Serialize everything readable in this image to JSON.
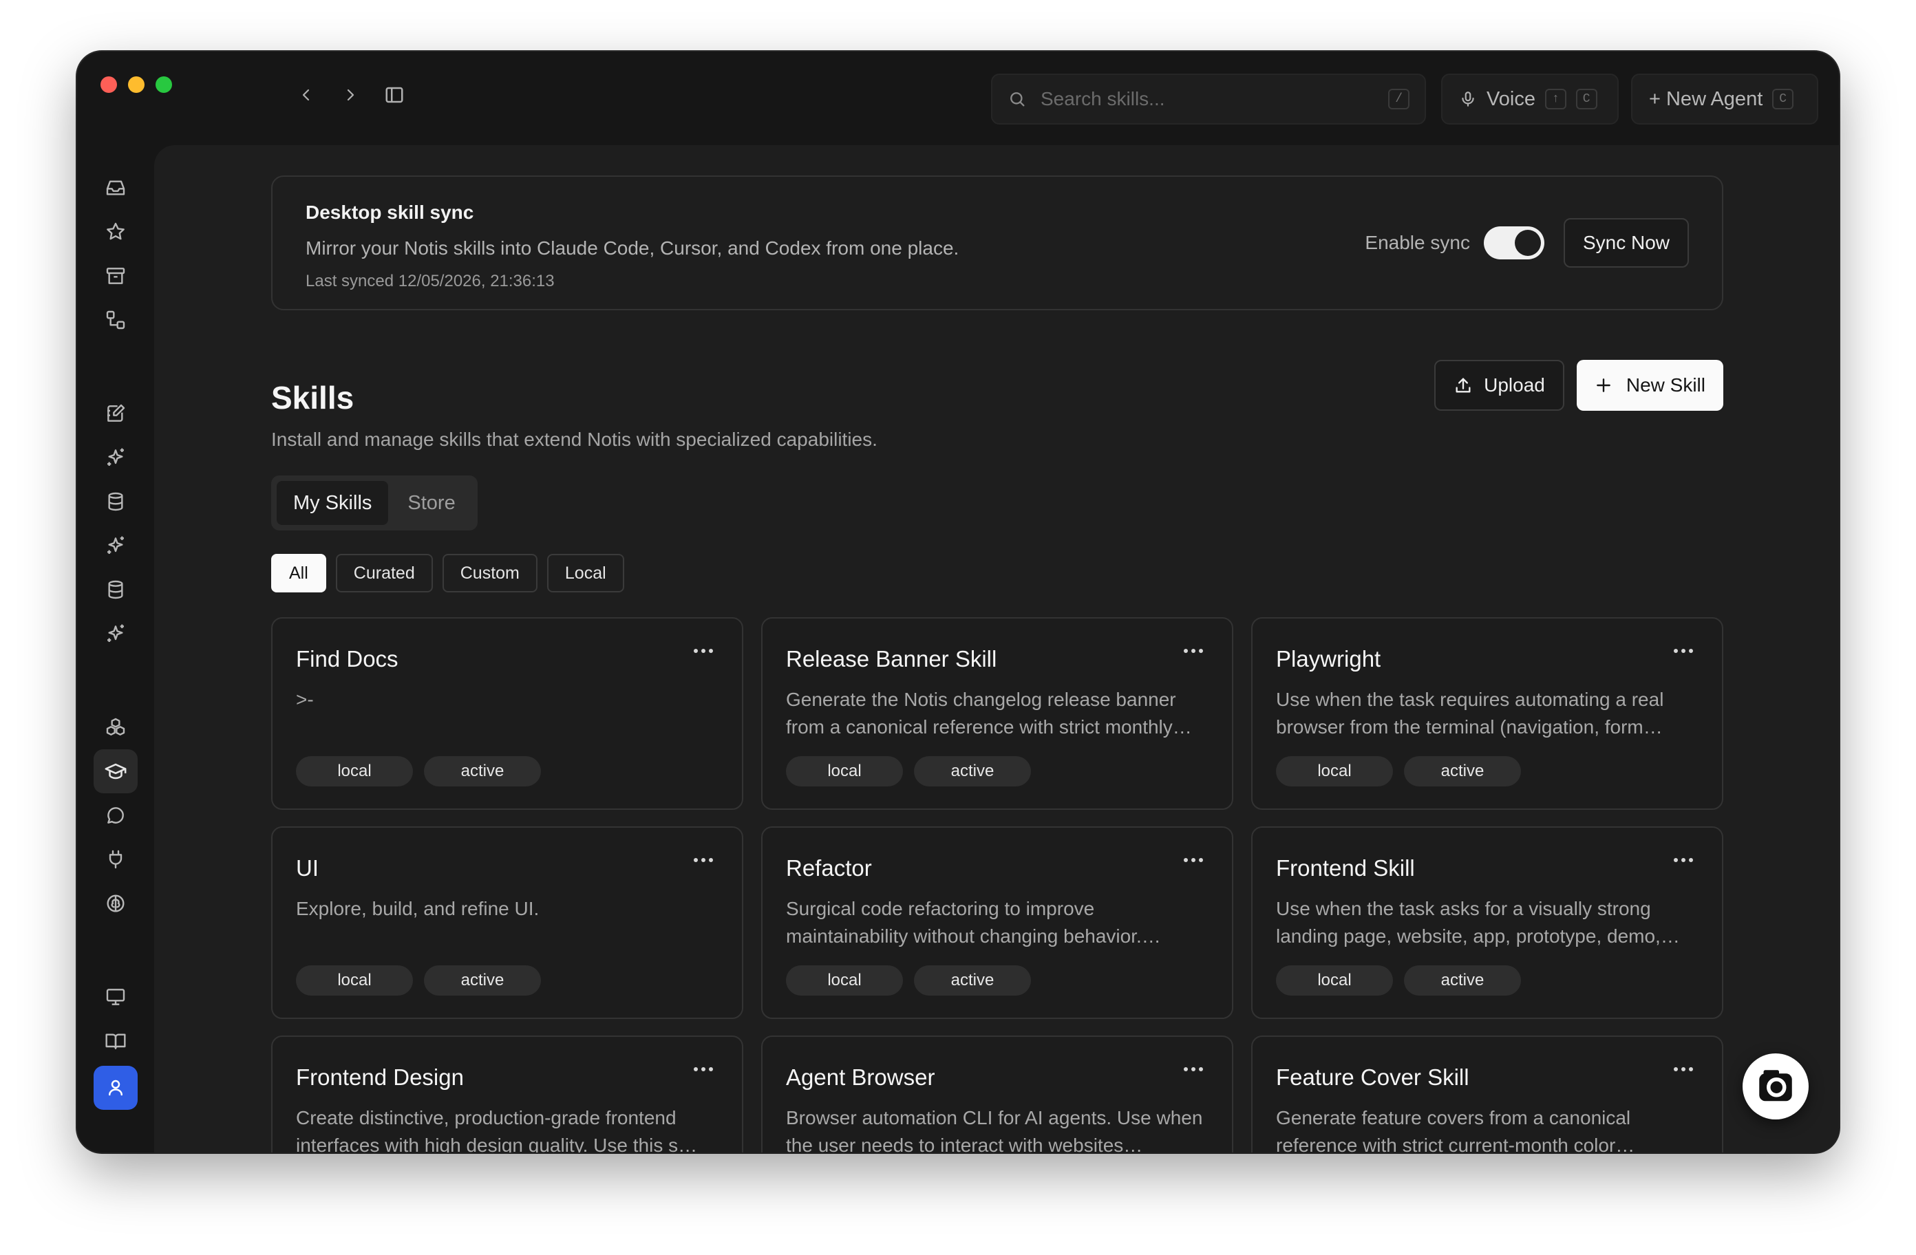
{
  "topbar": {
    "search_placeholder": "Search skills...",
    "search_shortcut": "/",
    "voice_label": "Voice",
    "voice_shortcut_1": "↑",
    "voice_shortcut_2": "C",
    "new_agent_label": "+ New Agent",
    "new_agent_shortcut": "C"
  },
  "sidebar": {
    "icons": [
      "inbox-icon",
      "star-icon",
      "archive-icon",
      "workflow-icon",
      "notebook-pen-icon",
      "sparkles-icon",
      "database-icon",
      "sparkles-icon",
      "database-icon",
      "sparkles-icon",
      "boxes-icon",
      "graduation-cap-icon",
      "message-circle-icon",
      "plug-icon",
      "brain-icon",
      "monitor-icon",
      "book-open-icon",
      "user-icon"
    ],
    "selected": "graduation-cap-icon"
  },
  "sync": {
    "title": "Desktop skill sync",
    "description": "Mirror your Notis skills into Claude Code, Cursor, and Codex from one place.",
    "last_synced": "Last synced 12/05/2026, 21:36:13",
    "enable_label": "Enable sync",
    "enabled": true,
    "sync_now_label": "Sync Now"
  },
  "page": {
    "title": "Skills",
    "subtitle": "Install and manage skills that extend Notis with specialized capabilities.",
    "upload_label": "Upload",
    "new_skill_label": "New Skill"
  },
  "tabs": [
    {
      "label": "My Skills",
      "active": true
    },
    {
      "label": "Store",
      "active": false
    }
  ],
  "filters": [
    {
      "label": "All",
      "active": true
    },
    {
      "label": "Curated",
      "active": false
    },
    {
      "label": "Custom",
      "active": false
    },
    {
      "label": "Local",
      "active": false
    }
  ],
  "skills": [
    {
      "title": "Find Docs",
      "description": ">-",
      "tags": [
        "local",
        "active"
      ]
    },
    {
      "title": "Release Banner Skill",
      "description": "Generate the Notis changelog release banner from a canonical reference with strict monthly…",
      "tags": [
        "local",
        "active"
      ]
    },
    {
      "title": "Playwright",
      "description": "Use when the task requires automating a real browser from the terminal (navigation, form…",
      "tags": [
        "local",
        "active"
      ]
    },
    {
      "title": "UI",
      "description": "Explore, build, and refine UI.",
      "tags": [
        "local",
        "active"
      ]
    },
    {
      "title": "Refactor",
      "description": "Surgical code refactoring to improve maintainability without changing behavior.…",
      "tags": [
        "local",
        "active"
      ]
    },
    {
      "title": "Frontend Skill",
      "description": "Use when the task asks for a visually strong landing page, website, app, prototype, demo,…",
      "tags": [
        "local",
        "active"
      ]
    },
    {
      "title": "Frontend Design",
      "description": "Create distinctive, production-grade frontend interfaces with high design quality. Use this s…",
      "tags": [
        "local",
        "active"
      ]
    },
    {
      "title": "Agent Browser",
      "description": "Browser automation CLI for AI agents. Use when the user needs to interact with websites…",
      "tags": [
        "local",
        "active"
      ]
    },
    {
      "title": "Feature Cover Skill",
      "description": "Generate feature covers from a canonical reference with strict current-month color…",
      "tags": [
        "local",
        "active"
      ]
    }
  ],
  "colors": {
    "accent_user": "#2f5ee6",
    "window_bg": "#161616",
    "panel_bg": "#1e1e1e"
  }
}
